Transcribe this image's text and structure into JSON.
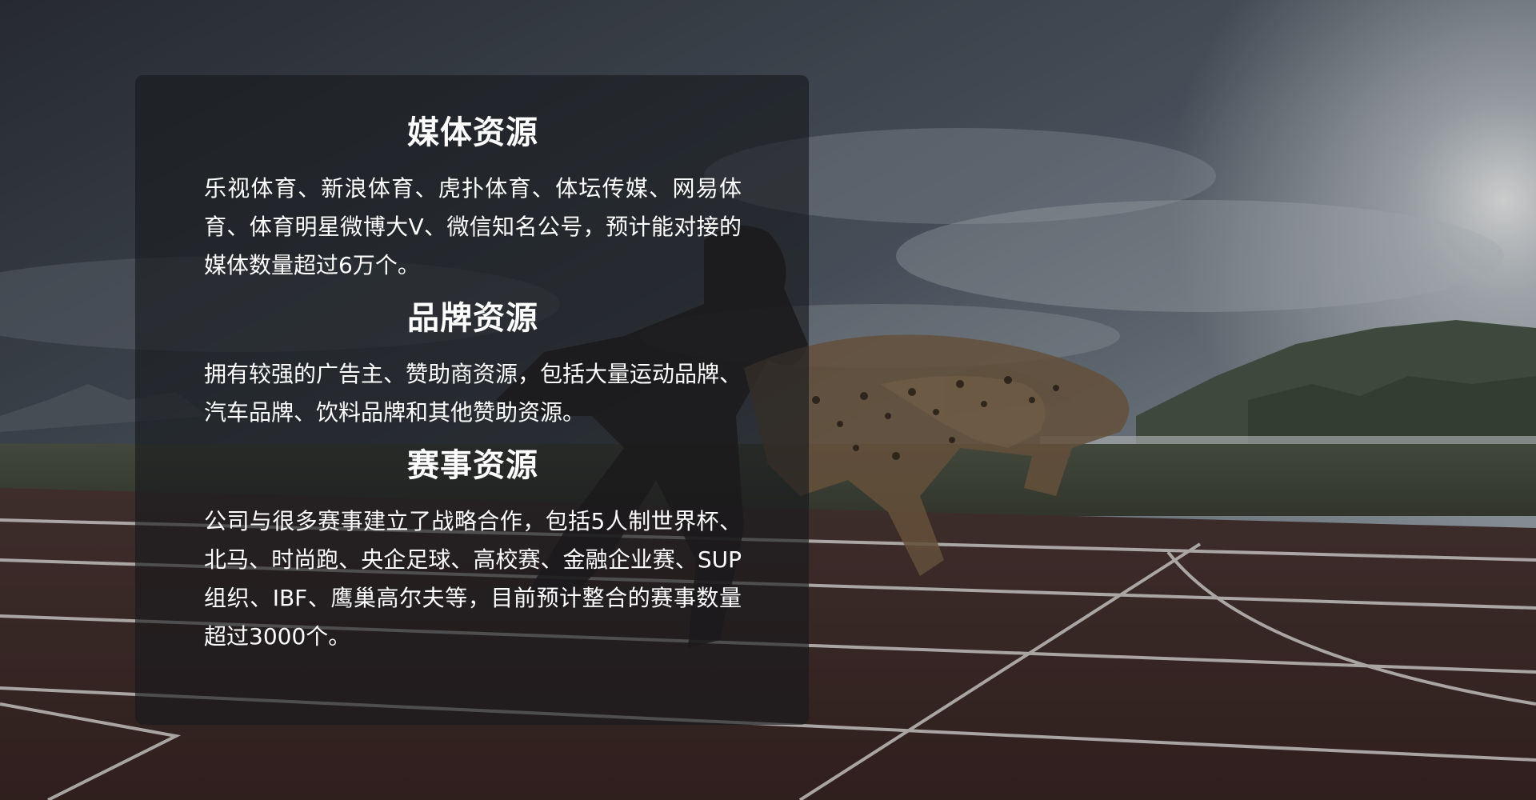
{
  "sections": [
    {
      "title": "媒体资源",
      "body": "乐视体育、新浪体育、虎扑体育、体坛传媒、网易体育、体育明星微博大V、微信知名公号，预计能对接的媒体数量超过6万个。"
    },
    {
      "title": "品牌资源",
      "body": "拥有较强的广告主、赞助商资源，包括大量运动品牌、汽车品牌、饮料品牌和其他赞助资源。"
    },
    {
      "title": "赛事资源",
      "body": "公司与很多赛事建立了战略合作，包括5人制世界杯、北马、时尚跑、央企足球、高校赛、金融企业赛、SUP组织、IBF、鹰巢高尔夫等，目前预计整合的赛事数量超过3000个。"
    }
  ],
  "colors": {
    "sky_top": "#3a3f48",
    "sky_glow": "#d8dde2",
    "track": "#5a3a36",
    "grass": "#4a4f3e",
    "panel": "#16181c"
  }
}
